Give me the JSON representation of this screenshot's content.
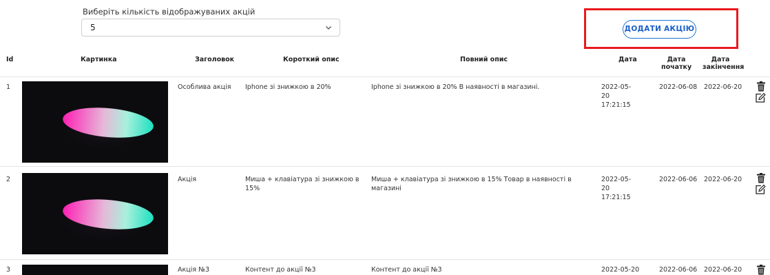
{
  "controls": {
    "select_label": "Виберіть кількість відображуваних акцій",
    "select_value": "5",
    "add_button": "ДОДАТИ АКЦІЮ"
  },
  "table": {
    "headers": [
      "Id",
      "Картинка",
      "Заголовок",
      "Короткий опис",
      "Повний опис",
      "Дата",
      "Дата початку",
      "Дата закінчення"
    ],
    "rows": [
      {
        "id": "1",
        "title": "Особлива акція",
        "short": "Iphone зі знижкою в 20%",
        "full": "Iphone зі знижкою в 20% В наявності в магазині.",
        "date": "2022-05-20 17:21:15",
        "start": "2022-06-08",
        "end": "2022-06-20"
      },
      {
        "id": "2",
        "title": "Акція",
        "short": "Миша + клавіатура зі знижкою в 15%",
        "full": "Миша + клавіатура зі знижкою в 15% Товар в наявності в магазині",
        "date": "2022-05-20 17:21:15",
        "start": "2022-06-06",
        "end": "2022-06-20"
      },
      {
        "id": "3",
        "title": "Акція №3",
        "short": "Контент до акції №3",
        "full": "Контент до акції №3",
        "date": "2022-05-20",
        "start": "2022-06-06",
        "end": "2022-06-20"
      }
    ]
  },
  "colors": {
    "accent": "#1a73d9",
    "highlight": "#e8181e"
  }
}
